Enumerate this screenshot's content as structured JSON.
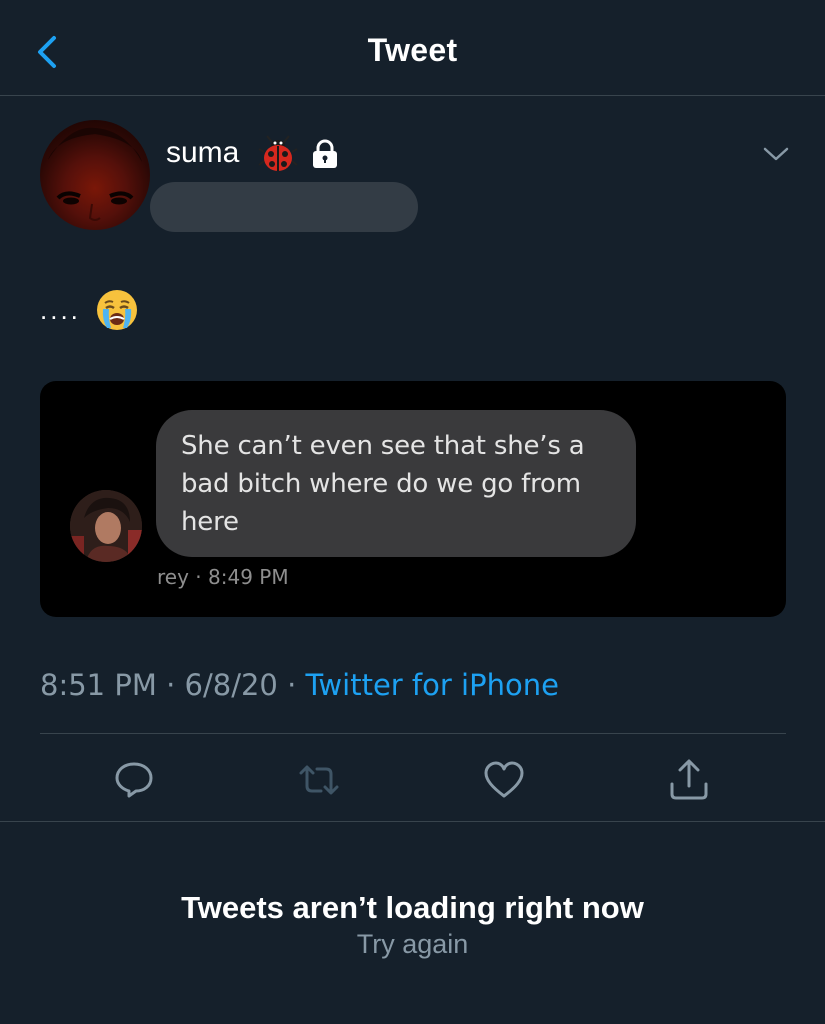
{
  "header": {
    "title": "Tweet"
  },
  "author": {
    "name": "suma"
  },
  "tweet": {
    "text": "...."
  },
  "media": {
    "dm_text": "She can’t even see that she’s a bad bitch where do we go from here",
    "sender": "rey",
    "time": "8:49 PM"
  },
  "meta": {
    "time": "8:51 PM",
    "date": "6/8/20",
    "separator": " · ",
    "source": "Twitter for iPhone"
  },
  "error": {
    "title": "Tweets aren’t loading right now",
    "retry": "Try again"
  },
  "colors": {
    "background": "#15202b",
    "accent": "#1da1f2",
    "muted": "#8899a6",
    "divider": "#38444d"
  },
  "icons": [
    "back-chevron",
    "ladybug-emoji",
    "lock",
    "chevron-down",
    "crying-face-emoji",
    "reply",
    "retweet",
    "like",
    "share"
  ]
}
